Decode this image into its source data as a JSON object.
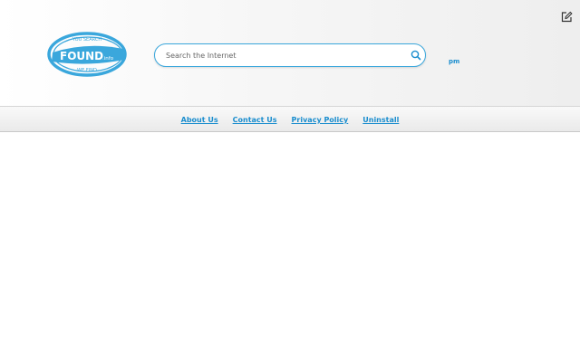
{
  "header": {
    "logo": {
      "top_text": "YOU SEARCH",
      "main_text": "FOUND",
      "suffix": ".info",
      "bottom_text": "WE FIND"
    },
    "search": {
      "placeholder": "Search the Internet",
      "value": ""
    },
    "time_text": "pm",
    "edit_icon": "edit-icon"
  },
  "nav": {
    "links": [
      {
        "label": "About Us"
      },
      {
        "label": "Contact Us"
      },
      {
        "label": "Privacy Policy"
      },
      {
        "label": "Uninstall"
      }
    ]
  },
  "colors": {
    "accent": "#1a8dce",
    "logo_blue": "#3aa7dc"
  }
}
